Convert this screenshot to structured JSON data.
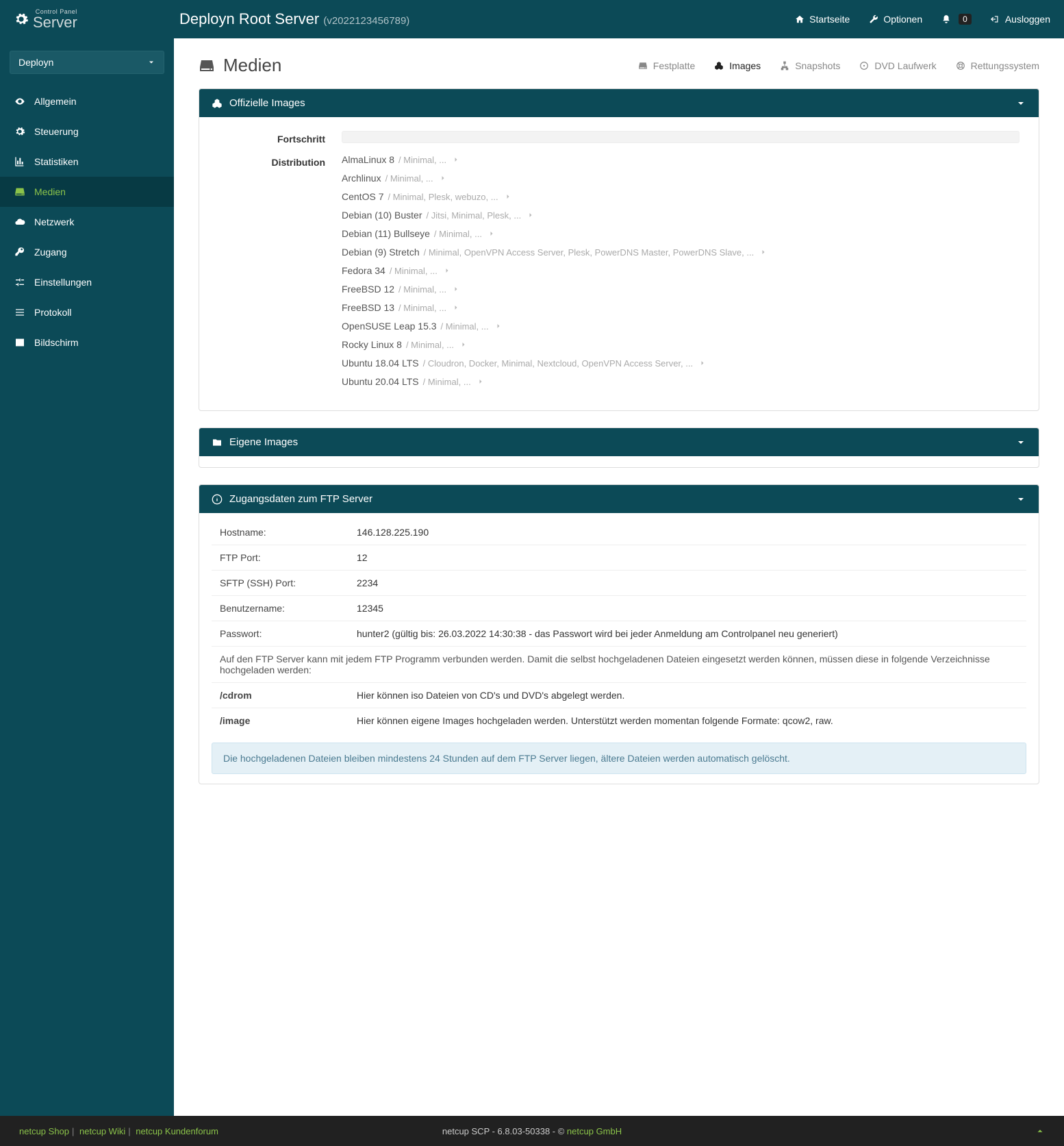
{
  "brand": {
    "small": "Control Panel",
    "big": "Server"
  },
  "header": {
    "title": "Deployn Root Server",
    "sub": "(v2022123456789)",
    "nav": {
      "home": "Startseite",
      "options": "Optionen",
      "notifications_count": "0",
      "logout": "Ausloggen"
    }
  },
  "sidebar": {
    "selector": "Deployn",
    "items": [
      {
        "key": "allgemein",
        "label": "Allgemein",
        "icon": "eye"
      },
      {
        "key": "steuerung",
        "label": "Steuerung",
        "icon": "gear"
      },
      {
        "key": "statistiken",
        "label": "Statistiken",
        "icon": "chart"
      },
      {
        "key": "medien",
        "label": "Medien",
        "icon": "hdd",
        "active": true
      },
      {
        "key": "netzwerk",
        "label": "Netzwerk",
        "icon": "cloud"
      },
      {
        "key": "zugang",
        "label": "Zugang",
        "icon": "key"
      },
      {
        "key": "einstellungen",
        "label": "Einstellungen",
        "icon": "sliders"
      },
      {
        "key": "protokoll",
        "label": "Protokoll",
        "icon": "list"
      },
      {
        "key": "bildschirm",
        "label": "Bildschirm",
        "icon": "terminal"
      }
    ]
  },
  "page": {
    "title": "Medien",
    "tabs": [
      {
        "key": "festplatte",
        "label": "Festplatte",
        "icon": "hdd"
      },
      {
        "key": "images",
        "label": "Images",
        "icon": "cubes",
        "active": true
      },
      {
        "key": "snapshots",
        "label": "Snapshots",
        "icon": "sitemap"
      },
      {
        "key": "dvd",
        "label": "DVD Laufwerk",
        "icon": "disc"
      },
      {
        "key": "rescue",
        "label": "Rettungssystem",
        "icon": "lifering"
      }
    ]
  },
  "panel_official": {
    "title": "Offizielle Images",
    "label_progress": "Fortschritt",
    "label_distribution": "Distribution",
    "distros": [
      {
        "name": "AlmaLinux 8",
        "opts": "/ Minimal, ..."
      },
      {
        "name": "Archlinux",
        "opts": "/ Minimal, ..."
      },
      {
        "name": "CentOS 7",
        "opts": "/ Minimal, Plesk, webuzo, ..."
      },
      {
        "name": "Debian (10) Buster",
        "opts": "/ Jitsi, Minimal, Plesk, ..."
      },
      {
        "name": "Debian (11) Bullseye",
        "opts": "/ Minimal, ..."
      },
      {
        "name": "Debian (9) Stretch",
        "opts": "/ Minimal, OpenVPN Access Server, Plesk, PowerDNS Master, PowerDNS Slave, ..."
      },
      {
        "name": "Fedora 34",
        "opts": "/ Minimal, ..."
      },
      {
        "name": "FreeBSD 12",
        "opts": "/ Minimal, ..."
      },
      {
        "name": "FreeBSD 13",
        "opts": "/ Minimal, ..."
      },
      {
        "name": "OpenSUSE Leap 15.3",
        "opts": "/ Minimal, ..."
      },
      {
        "name": "Rocky Linux 8",
        "opts": "/ Minimal, ..."
      },
      {
        "name": "Ubuntu 18.04 LTS",
        "opts": "/ Cloudron, Docker, Minimal, Nextcloud, OpenVPN Access Server, ..."
      },
      {
        "name": "Ubuntu 20.04 LTS",
        "opts": "/ Minimal, ..."
      }
    ]
  },
  "panel_own": {
    "title": "Eigene Images"
  },
  "panel_ftp": {
    "title": "Zugangsdaten zum FTP Server",
    "rows": {
      "hostname_k": "Hostname:",
      "hostname_v": "146.128.225.190",
      "ftp_k": "FTP Port:",
      "ftp_v": "12",
      "sftp_k": "SFTP (SSH) Port:",
      "sftp_v": "2234",
      "user_k": "Benutzername:",
      "user_v": "12345",
      "pass_k": "Passwort:",
      "pass_v": "hunter2 (gültig bis: 26.03.2022 14:30:38 - das Passwort wird bei jeder Anmeldung am Controlpanel neu generiert)"
    },
    "note": "Auf den FTP Server kann mit jedem FTP Programm verbunden werden. Damit die selbst hochgeladenen Dateien eingesetzt werden können, müssen diese in folgende Verzeichnisse hochgeladen werden:",
    "dir_cdrom_k": "/cdrom",
    "dir_cdrom_v": "Hier können iso Dateien von CD's und DVD's abgelegt werden.",
    "dir_image_k": "/image",
    "dir_image_v": "Hier können eigene Images hochgeladen werden. Unterstützt werden momentan folgende Formate: qcow2, raw.",
    "alert": "Die hochgeladenen Dateien bleiben mindestens 24 Stunden auf dem FTP Server liegen, ältere Dateien werden automatisch gelöscht."
  },
  "footer": {
    "shop": "netcup Shop",
    "wiki": "netcup Wiki",
    "forum": "netcup Kundenforum",
    "center_prefix": "netcup SCP - 6.8.03-50338 - © ",
    "center_link": "netcup GmbH"
  }
}
